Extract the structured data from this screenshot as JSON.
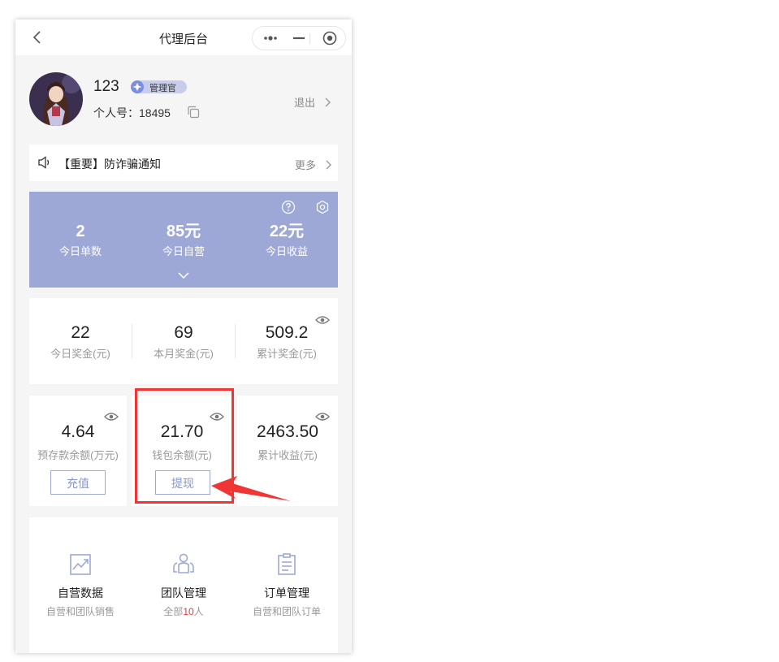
{
  "header": {
    "title": "代理后台"
  },
  "profile": {
    "name": "123",
    "role_badge": "管理官",
    "id_label": "个人号：",
    "id_value": "18495",
    "logout": "退出"
  },
  "notice": {
    "text": "【重要】防诈骗通知",
    "more": "更多"
  },
  "today_stats": [
    {
      "value": "2",
      "label": "今日单数"
    },
    {
      "value": "85元",
      "label": "今日自营"
    },
    {
      "value": "22元",
      "label": "今日收益"
    }
  ],
  "bonus": [
    {
      "value": "22",
      "label": "今日奖金(元)"
    },
    {
      "value": "69",
      "label": "本月奖金(元)"
    },
    {
      "value": "509.2",
      "label": "累计奖金(元)"
    }
  ],
  "balances": [
    {
      "value": "4.64",
      "label": "预存款余额(万元)",
      "button": "充值"
    },
    {
      "value": "21.70",
      "label": "钱包余额(元)",
      "button": "提现"
    },
    {
      "value": "2463.50",
      "label": "累计收益(元)"
    }
  ],
  "menu": [
    {
      "title": "自营数据",
      "subtitle": "自营和团队销售",
      "icon": "chart-icon"
    },
    {
      "title": "团队管理",
      "subtitle_prefix": "全部",
      "subtitle_count": "10",
      "subtitle_suffix": "人",
      "icon": "team-icon"
    },
    {
      "title": "订单管理",
      "subtitle": "自营和团队订单",
      "icon": "order-icon"
    }
  ],
  "colors": {
    "accent": "#9ea8d6",
    "highlight": "#f03535",
    "background": "#f5f5f5"
  }
}
